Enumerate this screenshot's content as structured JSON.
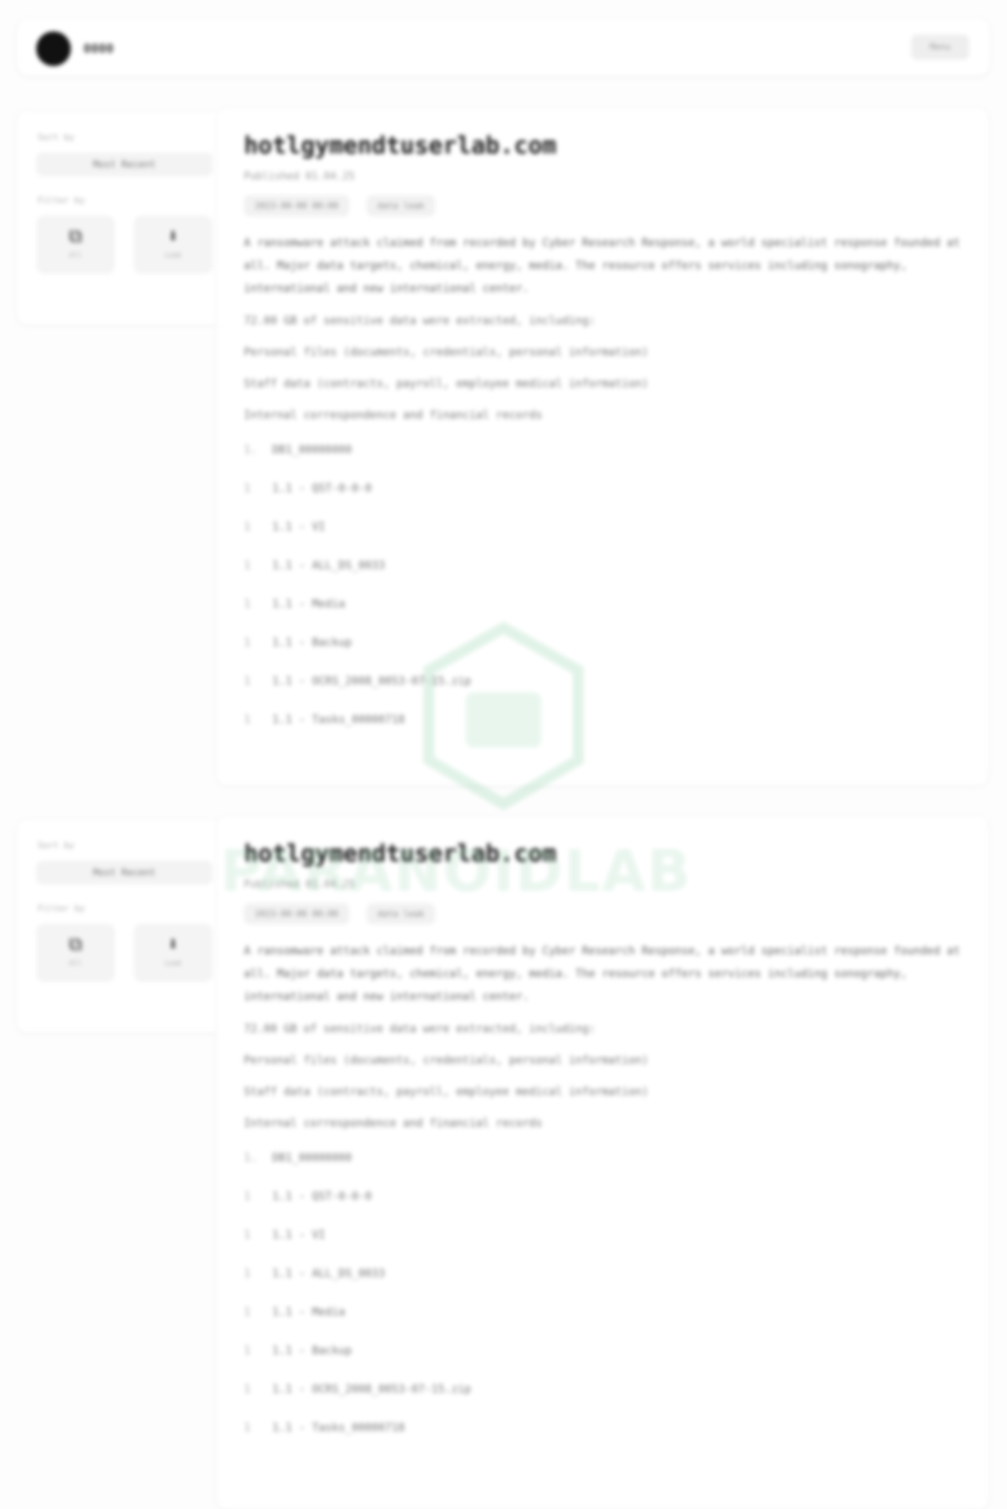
{
  "header": {
    "brand": "0000",
    "menu_label": "Menu"
  },
  "sidebar": {
    "sort_label": "Sort by",
    "sort_value": "Most Recent",
    "filter_label": "Filter by",
    "tiles": [
      {
        "icon": "stack-icon",
        "glyph": "⧉",
        "label": "All"
      },
      {
        "icon": "download-icon",
        "glyph": "⬇",
        "label": "Leak"
      }
    ]
  },
  "posts": [
    {
      "title": "hotlgymendtuserlab.com",
      "date": "Published 01.04.25",
      "tags": [
        "2023-00-00 00:00",
        "data leak"
      ],
      "description": "A ransomware attack claimed from recorded by Cyber Research Response, a world specialist response founded at all. Major data targets, chemical, energy, media. The resource offers services including sonography, international and new international center.",
      "lines": [
        "72.00 GB of sensitive data were extracted, including:",
        "Personal files (documents, credentials, personal information)",
        "Staff data (contracts, payroll, employee medical information)",
        "Internal correspondence and financial records"
      ],
      "list": [
        {
          "bullet": "1.",
          "text": "DB1_00000000"
        },
        {
          "bullet": "1",
          "text": "1.1 - QST-0-0-0"
        },
        {
          "bullet": "1",
          "text": "1.1 - VI"
        },
        {
          "bullet": "1",
          "text": "1.1 - ALL_DS_0033"
        },
        {
          "bullet": "1",
          "text": "1.1 - Media"
        },
        {
          "bullet": "1",
          "text": "1.1 - Backup"
        },
        {
          "bullet": "1",
          "text": "1.1 - OCRS_2008_0053-07-15.zip"
        },
        {
          "bullet": "1",
          "text": "1.1 - Tasks_00000718"
        }
      ]
    },
    {
      "title": "hotlgymendtuserlab.com",
      "date": "Published 01.04.25",
      "tags": [
        "2023-00-00 00:00",
        "data leak"
      ],
      "description": "A ransomware attack claimed from recorded by Cyber Research Response, a world specialist response founded at all. Major data targets, chemical, energy, media. The resource offers services including sonography, international and new international center.",
      "lines": [
        "72.00 GB of sensitive data were extracted, including:",
        "Personal files (documents, credentials, personal information)",
        "Staff data (contracts, payroll, employee medical information)",
        "Internal correspondence and financial records"
      ],
      "list": [
        {
          "bullet": "1.",
          "text": "DB1_00000000"
        },
        {
          "bullet": "1",
          "text": "1.1 - QST-0-0-0"
        },
        {
          "bullet": "1",
          "text": "1.1 - VI"
        },
        {
          "bullet": "1",
          "text": "1.1 - ALL_DS_0033"
        },
        {
          "bullet": "1",
          "text": "1.1 - Media"
        },
        {
          "bullet": "1",
          "text": "1.1 - Backup"
        },
        {
          "bullet": "1",
          "text": "1.1 - OCRS_2008_0053-07-15.zip"
        },
        {
          "bullet": "1",
          "text": "1.1 - Tasks_00000718"
        }
      ]
    }
  ],
  "watermark": {
    "text": "PARANOIDLAB"
  },
  "colors": {
    "accent": "#111111",
    "watermark": "#78c896"
  }
}
